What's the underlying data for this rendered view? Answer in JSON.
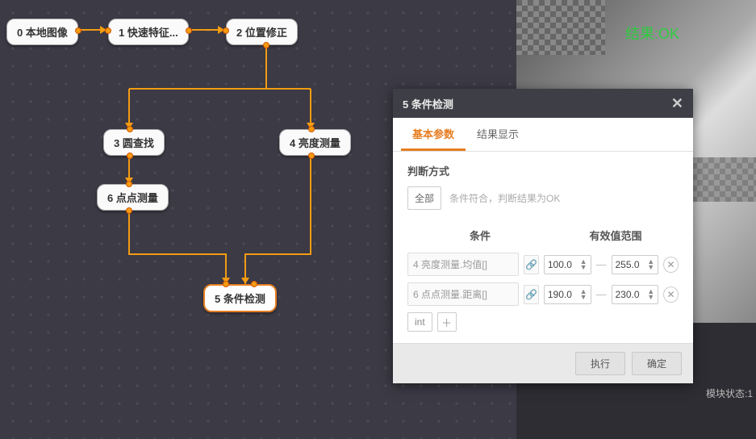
{
  "nodes": {
    "n0": "0 本地图像",
    "n1": "1 快速特征...",
    "n2": "2 位置修正",
    "n3": "3 圆查找",
    "n4": "4 亮度测量",
    "n5": "5 条件检测",
    "n6": "6 点点测量"
  },
  "preview": {
    "result_label": "结果:OK",
    "status": "模块状态:1"
  },
  "dialog": {
    "title": "5 条件检测",
    "tabs": {
      "basic": "基本参数",
      "result": "结果显示"
    },
    "judge_label": "判断方式",
    "judge_mode": "全部",
    "judge_hint": "条件符合，判断结果为OK",
    "col_cond": "条件",
    "col_range": "有效值范围",
    "rows": [
      {
        "name": "4 亮度测量.均值[]",
        "min": "100.0",
        "max": "255.0"
      },
      {
        "name": "6 点点测量.距离[]",
        "min": "190.0",
        "max": "230.0"
      }
    ],
    "type_sel": "int",
    "btn_exec": "执行",
    "btn_ok": "确定"
  }
}
